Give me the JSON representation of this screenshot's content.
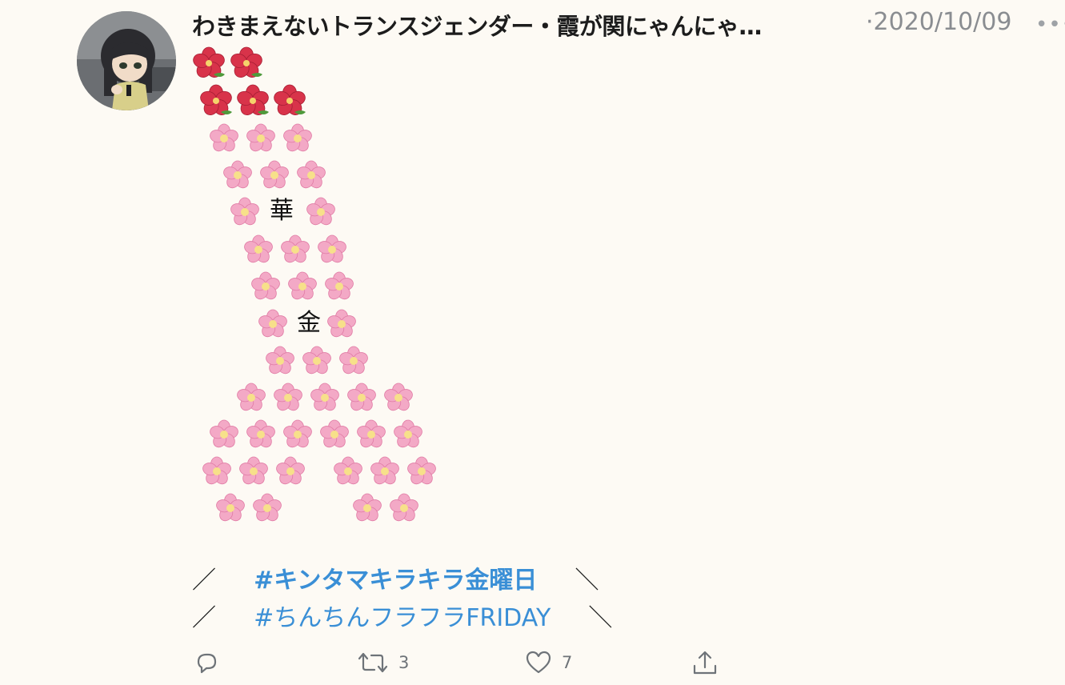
{
  "tweet": {
    "display_name": "わきまえないトランスジェンダー・霞が関にゃんにゃ…",
    "timestamp": "·2020/10/09",
    "more_icon": "more-horizontal-icon",
    "avatar_icon": "figurine-avatar",
    "art": {
      "hibiscus_emoji": "🌺",
      "blossom_emoji": "🌸",
      "glyph_1": "華",
      "glyph_2": "金"
    },
    "lines": [
      {
        "open": "／",
        "hashtag": "#キンタマキラキラ金曜日",
        "close": "＼"
      },
      {
        "open": "／",
        "hashtag": "#ちんちんフラフラFRIDAY",
        "close": "＼"
      }
    ],
    "actions": {
      "reply": {
        "icon": "reply-icon"
      },
      "retweet": {
        "icon": "retweet-icon",
        "count": "3"
      },
      "like": {
        "icon": "heart-icon",
        "count": "7"
      },
      "share": {
        "icon": "share-icon"
      }
    },
    "colors": {
      "hashtag": "#3a8fd6",
      "muted": "#8a8d91",
      "hibiscus": "#d8334a",
      "blossom": "#f3a9c6"
    }
  }
}
